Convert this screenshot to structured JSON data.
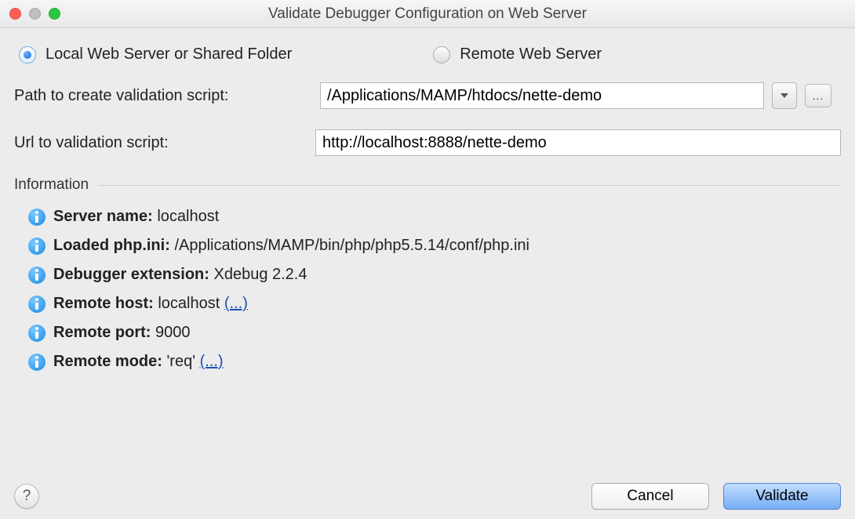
{
  "window": {
    "title": "Validate Debugger Configuration on Web Server"
  },
  "radios": {
    "local_label": "Local Web Server or Shared Folder",
    "remote_label": "Remote Web Server",
    "selected": "local"
  },
  "form": {
    "path_label": "Path to create validation script:",
    "path_value": "/Applications/MAMP/htdocs/nette-demo",
    "url_label": "Url to validation script:",
    "url_value": "http://localhost:8888/nette-demo"
  },
  "section": {
    "title": "Information"
  },
  "info": [
    {
      "label": "Server name:",
      "value": "localhost",
      "link": null
    },
    {
      "label": "Loaded php.ini:",
      "value": "/Applications/MAMP/bin/php/php5.5.14/conf/php.ini",
      "link": null
    },
    {
      "label": "Debugger extension:",
      "value": "Xdebug 2.2.4",
      "link": null
    },
    {
      "label": "Remote host:",
      "value": "localhost",
      "link": "(...)"
    },
    {
      "label": "Remote port:",
      "value": "9000",
      "link": null
    },
    {
      "label": "Remote mode:",
      "value": "'req'",
      "link": "(...)"
    }
  ],
  "footer": {
    "help_label": "?",
    "cancel_label": "Cancel",
    "validate_label": "Validate"
  },
  "icons": {
    "browse_ellipsis": "..."
  }
}
